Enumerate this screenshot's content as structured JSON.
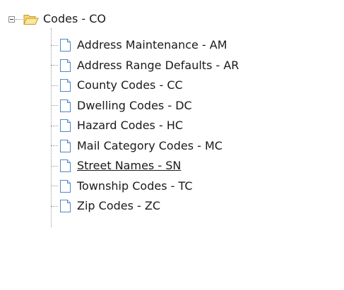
{
  "tree": {
    "root": {
      "label": "Codes - CO",
      "expanded": true,
      "icon": "folder-open-icon"
    },
    "items": [
      {
        "label": "Address Maintenance - AM",
        "icon": "document-icon"
      },
      {
        "label": "Address Range Defaults - AR",
        "icon": "document-icon"
      },
      {
        "label": "County Codes - CC",
        "icon": "document-icon"
      },
      {
        "label": "Dwelling Codes - DC",
        "icon": "document-icon"
      },
      {
        "label": "Hazard Codes - HC",
        "icon": "document-icon"
      },
      {
        "label": "Mail Category Codes - MC",
        "icon": "document-icon"
      },
      {
        "label": "Street Names - SN",
        "icon": "document-icon",
        "hovered": true
      },
      {
        "label": "Township Codes - TC",
        "icon": "document-icon"
      },
      {
        "label": "Zip Codes - ZC",
        "icon": "document-icon"
      }
    ],
    "colors": {
      "folder_fill": "#f6d978",
      "folder_stroke": "#c69a23",
      "doc_fill": "#ffffff",
      "doc_stroke": "#4f86c6",
      "connector": "#9a9a9a",
      "text": "#1a1a1a"
    }
  }
}
